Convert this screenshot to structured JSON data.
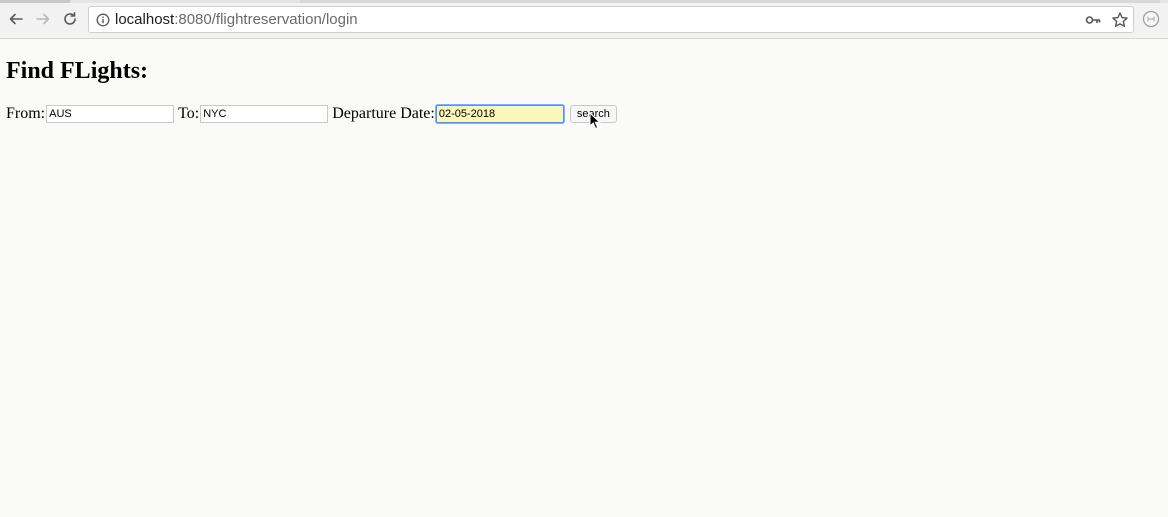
{
  "browser": {
    "url_host": "localhost",
    "url_rest": ":8080/flightreservation/login",
    "icons": {
      "back": "back-arrow-icon",
      "forward": "forward-arrow-icon",
      "reload": "reload-icon",
      "site_info": "info-icon",
      "password": "key-icon",
      "bookmark": "star-icon",
      "extension": "extension-icon"
    }
  },
  "page": {
    "heading": "Find FLights:",
    "form": {
      "from_label": "From:",
      "from_value": "AUS",
      "to_label": "To:",
      "to_value": "NYC",
      "date_label": "Departure Date:",
      "date_value": "02-05-2018",
      "search_label": "search"
    }
  },
  "colors": {
    "focus_ring": "#4d90fe",
    "autofill_bg": "#fbf7b8"
  }
}
